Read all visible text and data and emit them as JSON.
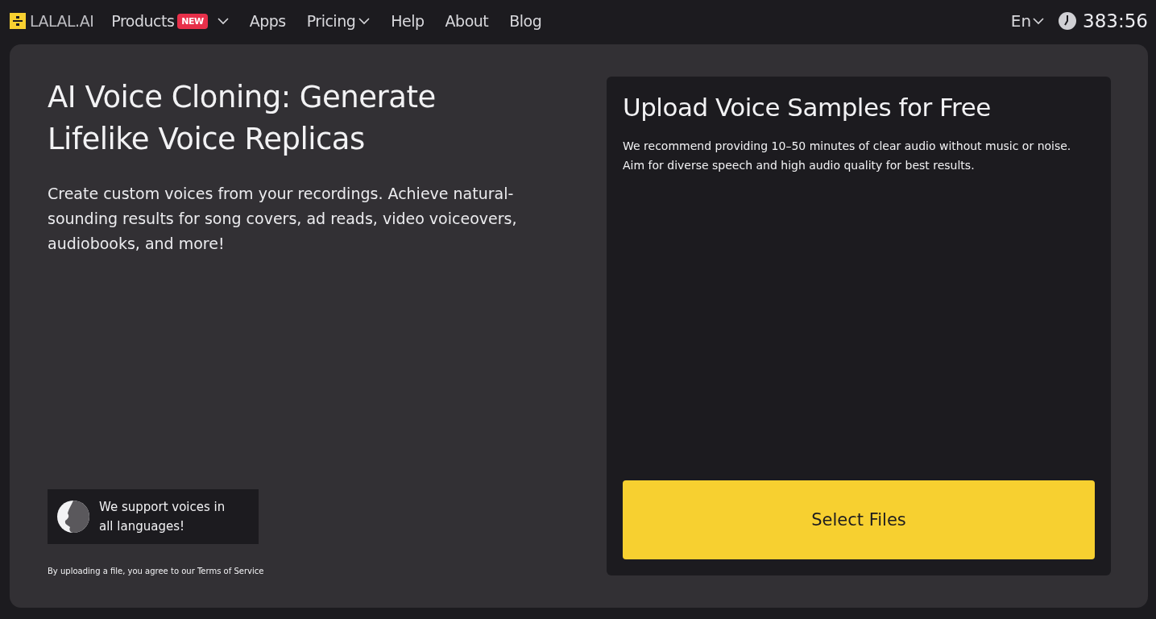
{
  "header": {
    "logo": "LALAL.AI",
    "nav": [
      {
        "label": "Products",
        "badge": "NEW",
        "has_menu": true
      },
      {
        "label": "Apps",
        "has_menu": false
      },
      {
        "label": "Pricing",
        "has_menu": true
      },
      {
        "label": "Help",
        "has_menu": false
      },
      {
        "label": "About",
        "has_menu": false
      },
      {
        "label": "Blog",
        "has_menu": false
      }
    ],
    "language": "En",
    "time_left": "383:56"
  },
  "hero": {
    "title": "AI Voice Cloning: Generate Lifelike Voice Replicas",
    "description": "Create custom voices from your recordings. Achieve natural-sounding results for song covers, ad reads, video voiceovers, audiobooks, and more!",
    "languages_note": "We support voices in all languages!",
    "terms_prefix": "By uploading a file, you agree to our",
    "terms_link": "Terms of Service"
  },
  "upload": {
    "title": "Upload Voice Samples for Free",
    "hint": "We recommend providing 10–50 minutes of clear audio without music or noise. Aim for diverse speech and high audio quality for best results.",
    "button": "Select Files"
  }
}
